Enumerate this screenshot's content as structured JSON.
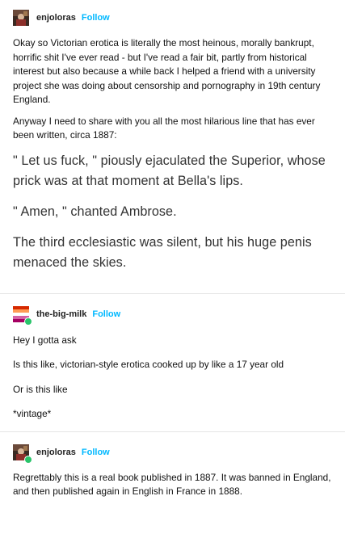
{
  "posts": [
    {
      "username": "enjoloras",
      "follow_label": "Follow",
      "paragraphs": [
        "Okay so Victorian erotica is literally the most heinous, morally bankrupt, horrific shit I've ever read - but I've read a fair bit, partly from historical interest but also because a while back I helped a friend with a university project she was doing about censorship and pornography in 19th century England.",
        "Anyway I need to share with you all the most hilarious line that has ever been written, circa 1887:"
      ],
      "quote": [
        "\" Let us fuck, \" piously ejaculated the Superior, whose prick was at that moment at Bella's lips.",
        "\" Amen, \" chanted Ambrose.",
        "The third ecclesiastic was silent, but his huge penis menaced the skies."
      ]
    },
    {
      "username": "the-big-milk",
      "follow_label": "Follow",
      "paragraphs": [
        "Hey I gotta ask",
        "Is this like, victorian-style erotica cooked up by like a 17 year old",
        "Or is this like",
        "*vintage*"
      ]
    },
    {
      "username": "enjoloras",
      "follow_label": "Follow",
      "paragraphs": [
        "Regrettably this is a real book published in 1887. It was banned in England, and then published again in English in France in 1888."
      ]
    }
  ],
  "colors": {
    "follow": "#00b8ff",
    "badge": "#29c46a",
    "divider": "#e6e6e6"
  },
  "icons": [
    "avatar-enjoloras",
    "avatar-the-big-milk",
    "online-badge-icon"
  ]
}
